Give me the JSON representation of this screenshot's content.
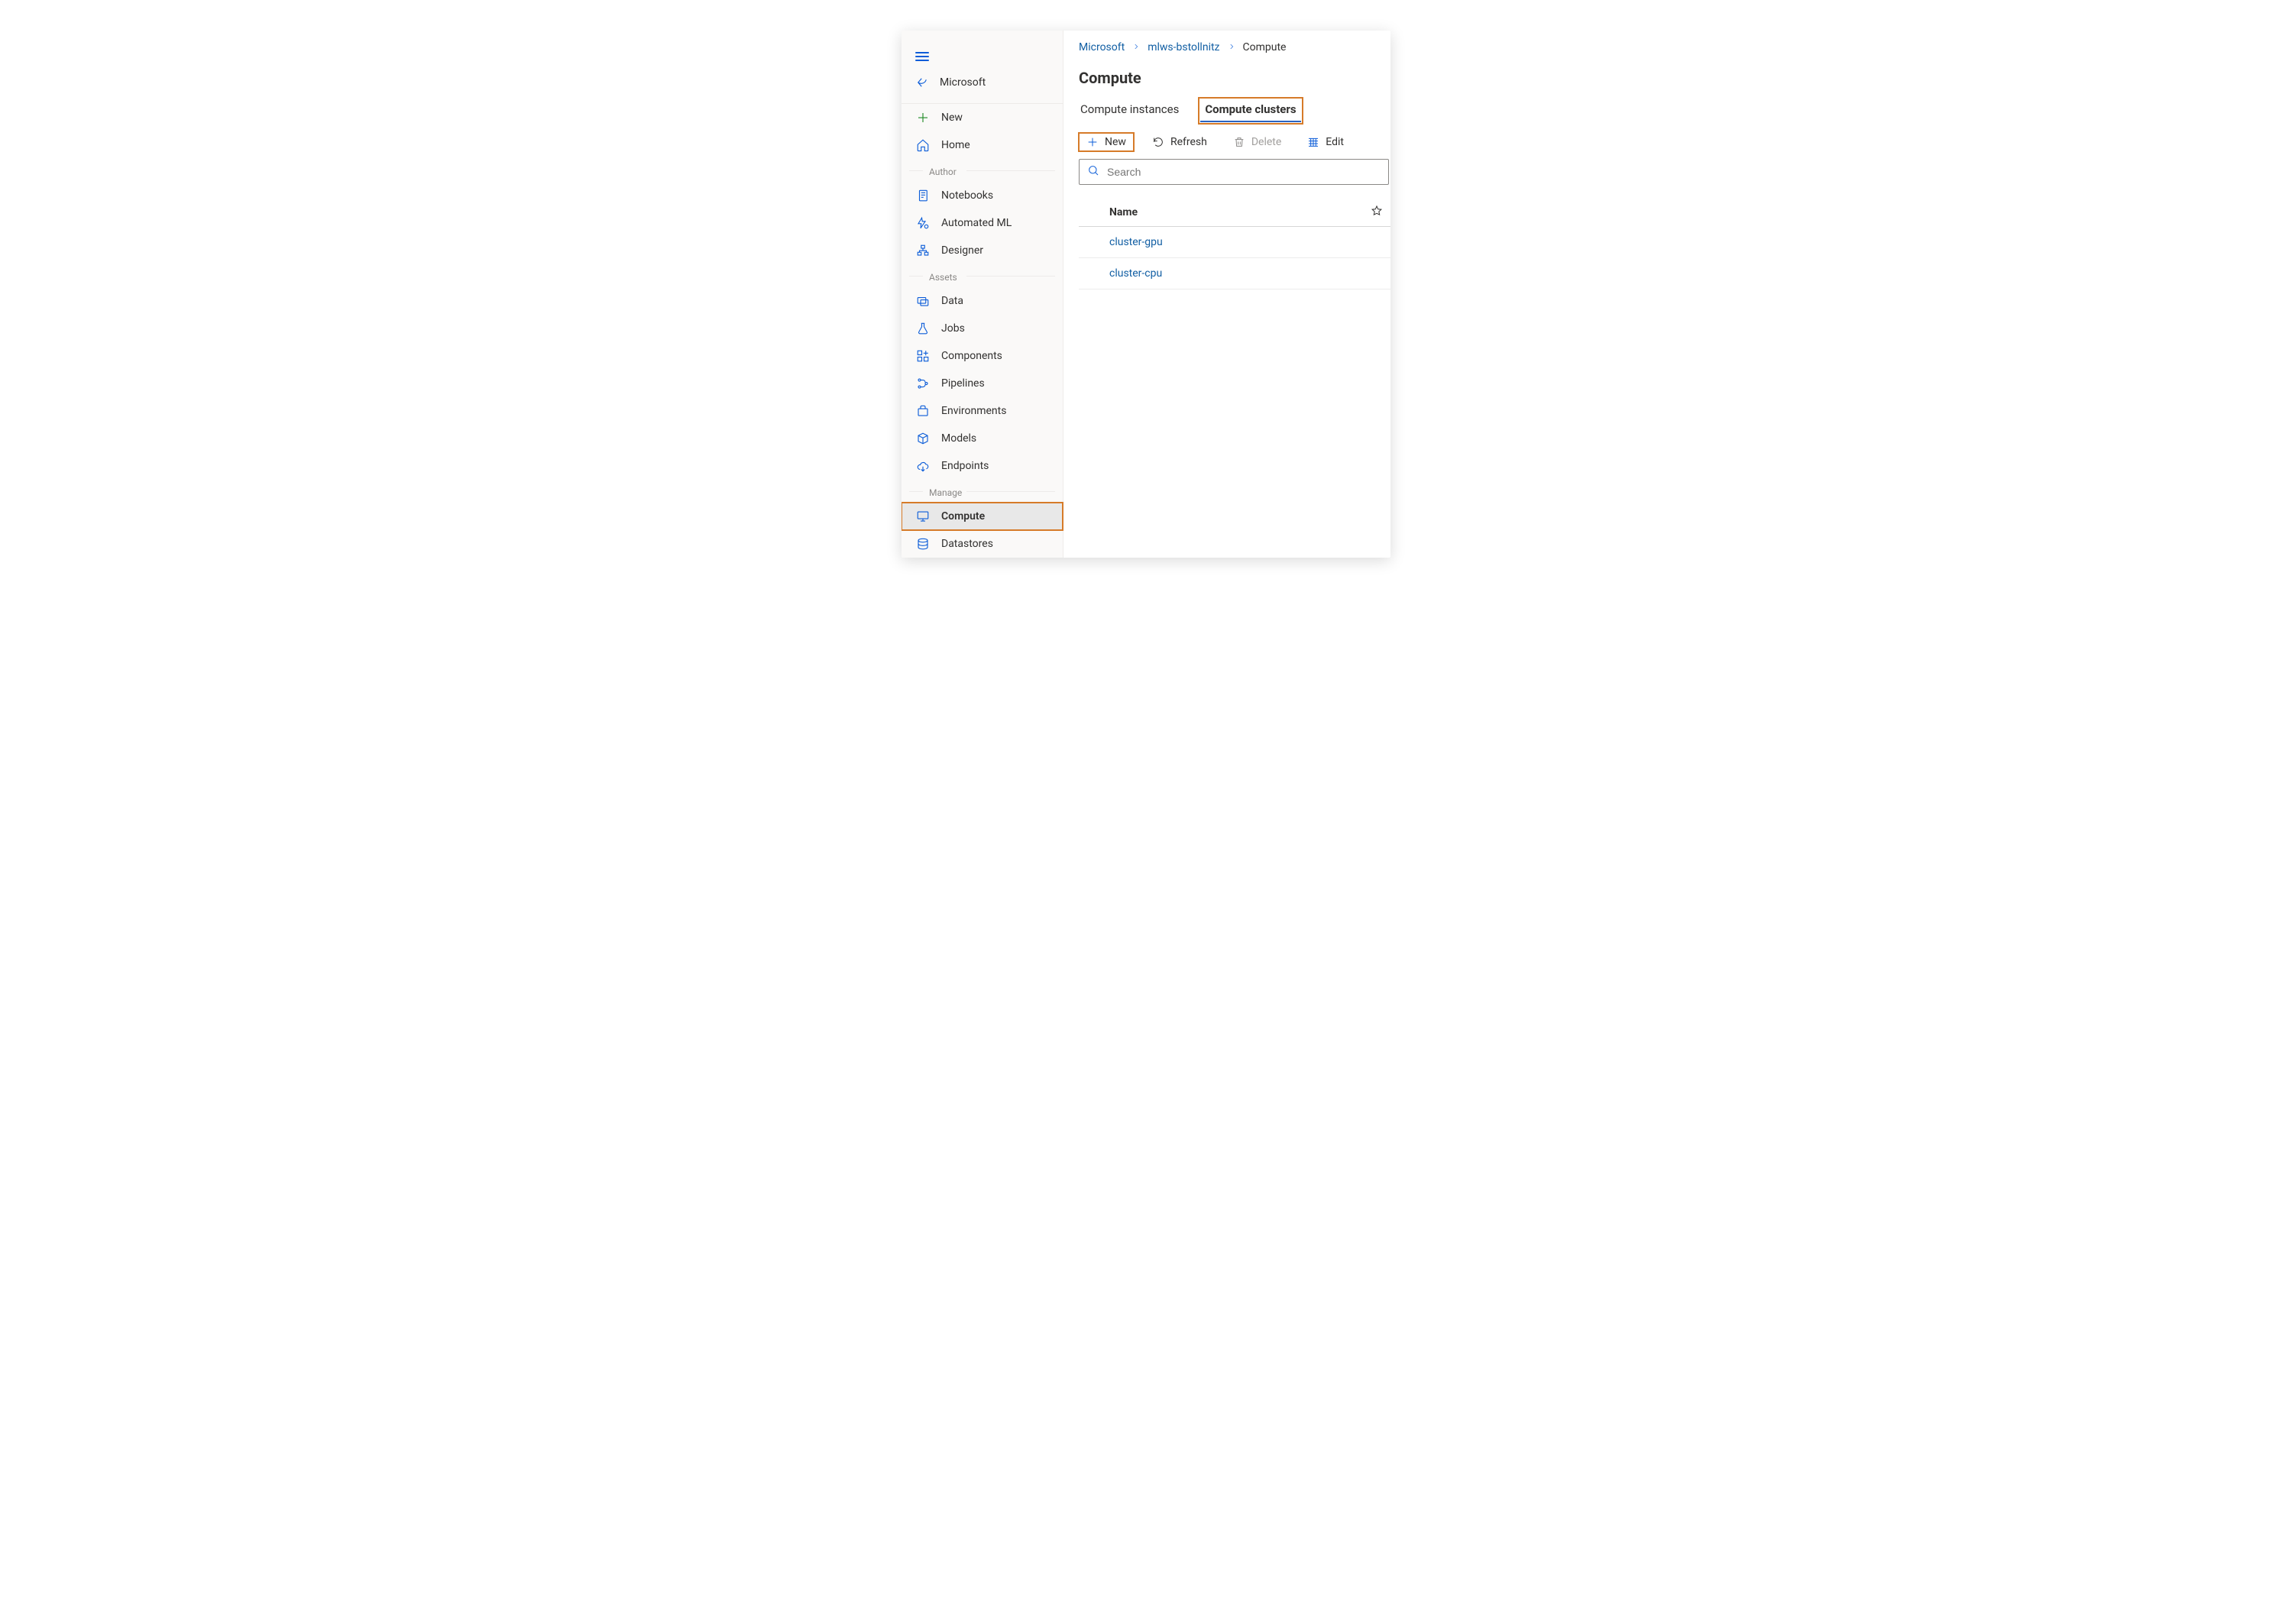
{
  "sidebar": {
    "back_label": "Microsoft",
    "items": {
      "new": "New",
      "home": "Home",
      "author_section": "Author",
      "notebooks": "Notebooks",
      "automl": "Automated ML",
      "designer": "Designer",
      "assets_section": "Assets",
      "data": "Data",
      "jobs": "Jobs",
      "components": "Components",
      "pipelines": "Pipelines",
      "environments": "Environments",
      "models": "Models",
      "endpoints": "Endpoints",
      "manage_section": "Manage",
      "compute": "Compute",
      "datastores": "Datastores"
    }
  },
  "breadcrumb": {
    "segments": [
      "Microsoft",
      "mlws-bstollnitz",
      "Compute"
    ]
  },
  "page": {
    "title": "Compute"
  },
  "tabs": {
    "instances": "Compute instances",
    "clusters": "Compute clusters"
  },
  "toolbar": {
    "new": "New",
    "refresh": "Refresh",
    "delete": "Delete",
    "edit": "Edit"
  },
  "search": {
    "placeholder": "Search"
  },
  "table": {
    "columns": {
      "name": "Name"
    },
    "rows": [
      {
        "name": "cluster-gpu"
      },
      {
        "name": "cluster-cpu"
      }
    ]
  }
}
